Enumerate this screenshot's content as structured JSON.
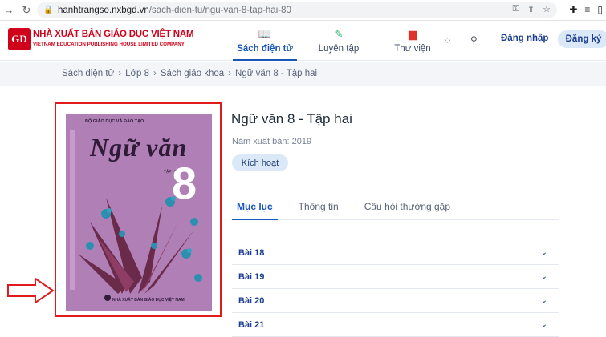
{
  "browser": {
    "url_host": "hanhtrangso.nxbgd.vn",
    "url_path": "/sach-dien-tu/ngu-van-8-tap-hai-80"
  },
  "header": {
    "logo_title": "NHÀ XUẤT BẢN GIÁO DỤC VIỆT NAM",
    "logo_subtitle": "VIETNAM EDUCATION PUBLISHING HOUSE LIMITED COMPANY",
    "nav": [
      {
        "label": "Sách điện tử"
      },
      {
        "label": "Luyện tập"
      },
      {
        "label": "Thư viện"
      }
    ],
    "login_label": "Đăng nhập",
    "signup_label": "Đăng ký"
  },
  "breadcrumb": [
    "Sách điện tử",
    "Lớp 8",
    "Sách giáo khoa",
    "Ngữ văn 8 - Tập hai"
  ],
  "cover": {
    "publisher_top": "BỘ GIÁO DỤC VÀ ĐÀO TẠO",
    "title": "Ngữ văn",
    "volume": "TẬP HAI",
    "grade": "8",
    "publisher_bottom": "NHÀ XUẤT BẢN GIÁO DỤC VIỆT NAM"
  },
  "book": {
    "title": "Ngữ văn 8 - Tập hai",
    "year_label": "Năm xuất bản: 2019",
    "activate_label": "Kích hoạt"
  },
  "tabs": [
    {
      "label": "Mục lục"
    },
    {
      "label": "Thông tin"
    },
    {
      "label": "Câu hỏi thường gặp"
    }
  ],
  "lessons": [
    {
      "label": "Bài 18"
    },
    {
      "label": "Bài 19"
    },
    {
      "label": "Bài 20"
    },
    {
      "label": "Bài 21"
    }
  ],
  "colors": {
    "accent": "#1a56b8",
    "brand_red": "#d0021b",
    "highlight": "#e11b1b",
    "cover": "#b07fb5"
  }
}
